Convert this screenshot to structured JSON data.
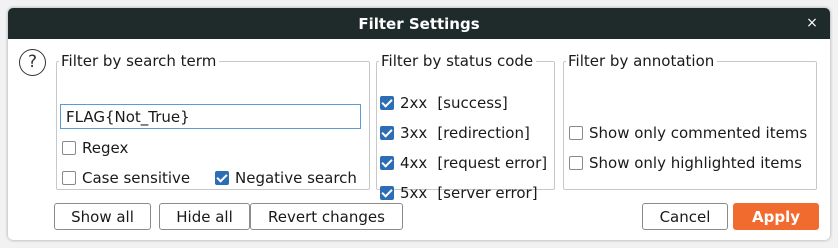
{
  "window": {
    "title": "Filter Settings",
    "close_glyph": "×"
  },
  "help": {
    "glyph": "?"
  },
  "search_group": {
    "legend": "Filter by search term",
    "input_value": "FLAG{Not_True}",
    "regex": {
      "label": "Regex",
      "checked": false
    },
    "case_sensitive": {
      "label": "Case sensitive",
      "checked": false
    },
    "negative_search": {
      "label": "Negative search",
      "checked": true
    }
  },
  "status_group": {
    "legend": "Filter by status code",
    "items": [
      {
        "code": "2xx",
        "desc": "[success]",
        "checked": true
      },
      {
        "code": "3xx",
        "desc": "[redirection]",
        "checked": true
      },
      {
        "code": "4xx",
        "desc": "[request error]",
        "checked": true
      },
      {
        "code": "5xx",
        "desc": "[server error]",
        "checked": true
      }
    ]
  },
  "annotation_group": {
    "legend": "Filter by annotation",
    "commented": {
      "label": "Show only commented items",
      "checked": false
    },
    "highlighted": {
      "label": "Show only highlighted items",
      "checked": false
    }
  },
  "buttons": {
    "show_all": "Show all",
    "hide_all": "Hide all",
    "revert": "Revert changes",
    "cancel": "Cancel",
    "apply": "Apply"
  },
  "colors": {
    "titlebar": "#1f2a2a",
    "accent": "#f26b2e",
    "checkbox": "#2d6db5"
  }
}
